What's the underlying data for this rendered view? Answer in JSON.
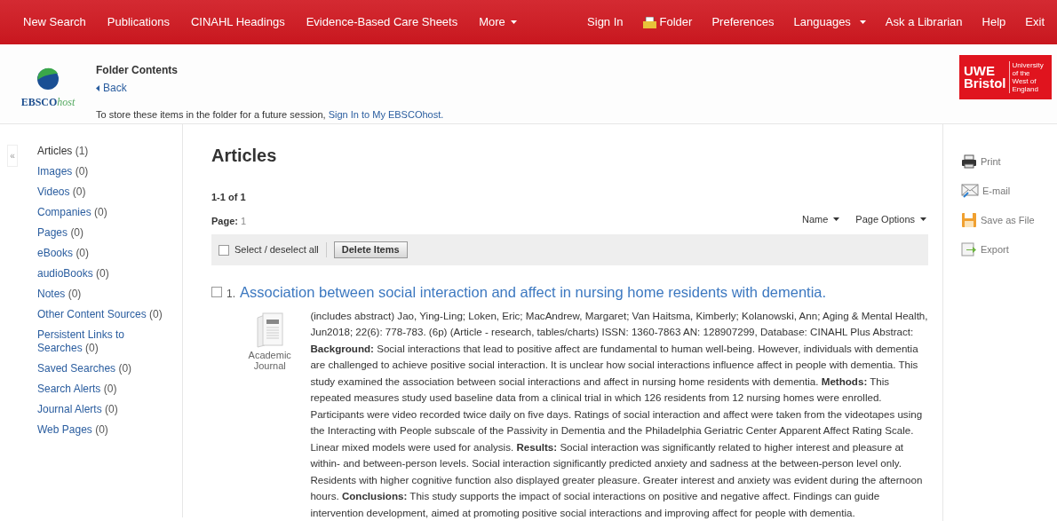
{
  "nav": {
    "left": [
      {
        "label": "New Search",
        "dropdown": false
      },
      {
        "label": "Publications",
        "dropdown": false
      },
      {
        "label": "CINAHL Headings",
        "dropdown": false
      },
      {
        "label": "Evidence-Based Care Sheets",
        "dropdown": false
      },
      {
        "label": "More",
        "dropdown": true
      }
    ],
    "right": [
      {
        "label": "Sign In",
        "kind": "link",
        "dropdown": false
      },
      {
        "label": "Folder",
        "kind": "folder",
        "dropdown": false
      },
      {
        "label": "Preferences",
        "kind": "link",
        "dropdown": false
      },
      {
        "label": "Languages",
        "kind": "link",
        "dropdown": true
      },
      {
        "label": "Ask a Librarian",
        "kind": "link",
        "dropdown": false
      },
      {
        "label": "Help",
        "kind": "link",
        "dropdown": false
      },
      {
        "label": "Exit",
        "kind": "link",
        "dropdown": false
      }
    ]
  },
  "header": {
    "logo": {
      "brand": "EBSCO",
      "suffix": "host"
    },
    "title": "Folder Contents",
    "back": "Back",
    "message": "To store these items in the folder for a future session, ",
    "sign_in_link": "Sign In to My EBSCOhost.",
    "partner_logo": {
      "line_1": "UWE",
      "line_2": "Bristol",
      "caption": [
        "University",
        "of the",
        "West of",
        "England"
      ]
    }
  },
  "sidebar": {
    "collapse": "«",
    "items": [
      {
        "label": "Articles",
        "count": "(1)",
        "selected": true
      },
      {
        "label": "Images",
        "count": "(0)",
        "selected": false
      },
      {
        "label": "Videos",
        "count": "(0)",
        "selected": false
      },
      {
        "label": "Companies",
        "count": "(0)",
        "selected": false
      },
      {
        "label": "Pages",
        "count": "(0)",
        "selected": false
      },
      {
        "label": "eBooks",
        "count": "(0)",
        "selected": false
      },
      {
        "label": "audioBooks",
        "count": "(0)",
        "selected": false
      },
      {
        "label": "Notes",
        "count": "(0)",
        "selected": false
      },
      {
        "label": "Other Content Sources",
        "count": "(0)",
        "selected": false
      },
      {
        "label": "Persistent Links to Searches",
        "count": "(0)",
        "selected": false
      },
      {
        "label": "Saved Searches",
        "count": "(0)",
        "selected": false
      },
      {
        "label": "Search Alerts",
        "count": "(0)",
        "selected": false
      },
      {
        "label": "Journal Alerts",
        "count": "(0)",
        "selected": false
      },
      {
        "label": "Web Pages",
        "count": "(0)",
        "selected": false
      }
    ]
  },
  "results": {
    "heading": "Articles",
    "range": "1-1 of 1",
    "page_label": "Page:",
    "page": "1",
    "sort": "Name",
    "page_options": "Page Options",
    "select_all": {
      "label": "Select / deselect all",
      "checked": false
    },
    "delete_button": "Delete Items",
    "records": [
      {
        "number": "1.",
        "checked": false,
        "title": "Association between social interaction and affect in nursing home residents with dementia.",
        "type": "Academic Journal",
        "details": "(includes abstract) Jao, Ying-Ling; Loken, Eric; MacAndrew, Margaret; Van Haitsma, Kimberly; Kolanowski, Ann; Aging & Mental Health, Jun2018; 22(6): 778-783. (6p) (Article - research, tables/charts) ISSN: 1360-7863 AN: 128907299, Database: CINAHL Plus Abstract: **Background:** Social interactions that lead to positive affect are fundamental to human well-being. However, individuals with dementia are challenged to achieve positive social interaction. It is unclear how social interactions influence affect in people with dementia. This study examined the association between social interactions and affect in nursing home residents with dementia. **Methods:** This repeated measures study used baseline data from a clinical trial in which 126 residents from 12 nursing homes were enrolled. Participants were video recorded twice daily on five days. Ratings of social interaction and affect were taken from the videotapes using the Interacting with People subscale of the Passivity in Dementia and the Philadelphia Geriatric Center Apparent Affect Rating Scale. Linear mixed models were used for analysis. **Results:** Social interaction was significantly related to higher interest and pleasure at within- and between-person levels. Social interaction significantly predicted anxiety and sadness at the between-person level only. Residents with higher cognitive function also displayed greater pleasure. Greater interest and anxiety was evident during the afternoon hours. **Conclusions:** This study supports the impact of social interactions on positive and negative affect. Findings can guide intervention development, aimed at promoting positive social interactions and improving affect for people with dementia."
      }
    ]
  },
  "tools": [
    {
      "label": "Print",
      "kind": "print"
    },
    {
      "label": "E-mail",
      "kind": "email"
    },
    {
      "label": "Save as File",
      "kind": "save"
    },
    {
      "label": "Export",
      "kind": "export"
    }
  ]
}
